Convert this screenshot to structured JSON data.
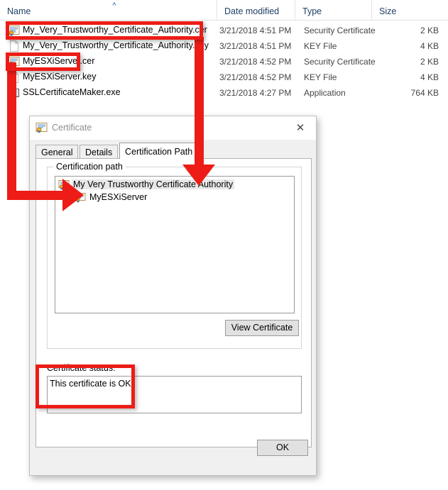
{
  "explorer": {
    "columns": [
      {
        "key": "name",
        "label": "Name",
        "sorted": true,
        "sort_direction": "ascending",
        "sort_glyph": "^"
      },
      {
        "key": "date",
        "label": "Date modified"
      },
      {
        "key": "type",
        "label": "Type"
      },
      {
        "key": "size",
        "label": "Size"
      }
    ],
    "rows": [
      {
        "name": "My_Very_Trustworthy_Certificate_Authority.cer",
        "date": "3/21/2018 4:51 PM",
        "type": "Security Certificate",
        "size": "2 KB",
        "icon": "certificate-file-icon"
      },
      {
        "name": "My_Very_Trustworthy_Certificate_Authority.key",
        "date": "3/21/2018 4:51 PM",
        "type": "KEY File",
        "size": "4 KB",
        "icon": "generic-file-icon"
      },
      {
        "name": "MyESXiServer.cer",
        "date": "3/21/2018 4:52 PM",
        "type": "Security Certificate",
        "size": "2 KB",
        "icon": "certificate-file-icon"
      },
      {
        "name": "MyESXiServer.key",
        "date": "3/21/2018 4:52 PM",
        "type": "KEY File",
        "size": "4 KB",
        "icon": "generic-file-icon"
      },
      {
        "name": "SSLCertificateMaker.exe",
        "date": "3/21/2018 4:27 PM",
        "type": "Application",
        "size": "764 KB",
        "icon": "application-exe-icon"
      }
    ]
  },
  "dialog": {
    "title": "Certificate",
    "close_label": "✕",
    "tabs": [
      {
        "label": "General",
        "active": false
      },
      {
        "label": "Details",
        "active": false
      },
      {
        "label": "Certification Path",
        "active": true
      }
    ],
    "group_legend": "Certification path",
    "tree": [
      {
        "label": "My Very Trustworthy Certificate Authority",
        "level": 0,
        "selected": true,
        "icon": "certificate-icon"
      },
      {
        "label": "MyESXiServer",
        "level": 1,
        "selected": false,
        "icon": "certificate-icon"
      }
    ],
    "view_certificate_label": "View Certificate",
    "status_label": "Certificate status:",
    "status_text": "This certificate is OK.",
    "ok_label": "OK"
  },
  "annotations": {
    "highlight_color": "#ed1c16",
    "items": [
      {
        "name": "highlight-ca-cer-row",
        "kind": "rect"
      },
      {
        "name": "highlight-server-cer-row",
        "kind": "rect"
      },
      {
        "name": "highlight-certificate-status",
        "kind": "rect"
      },
      {
        "name": "arrow-ca-to-tree-root",
        "kind": "arrow",
        "direction": "down"
      },
      {
        "name": "arrow-server-to-tree-child",
        "kind": "arrow",
        "direction": "right"
      }
    ]
  }
}
